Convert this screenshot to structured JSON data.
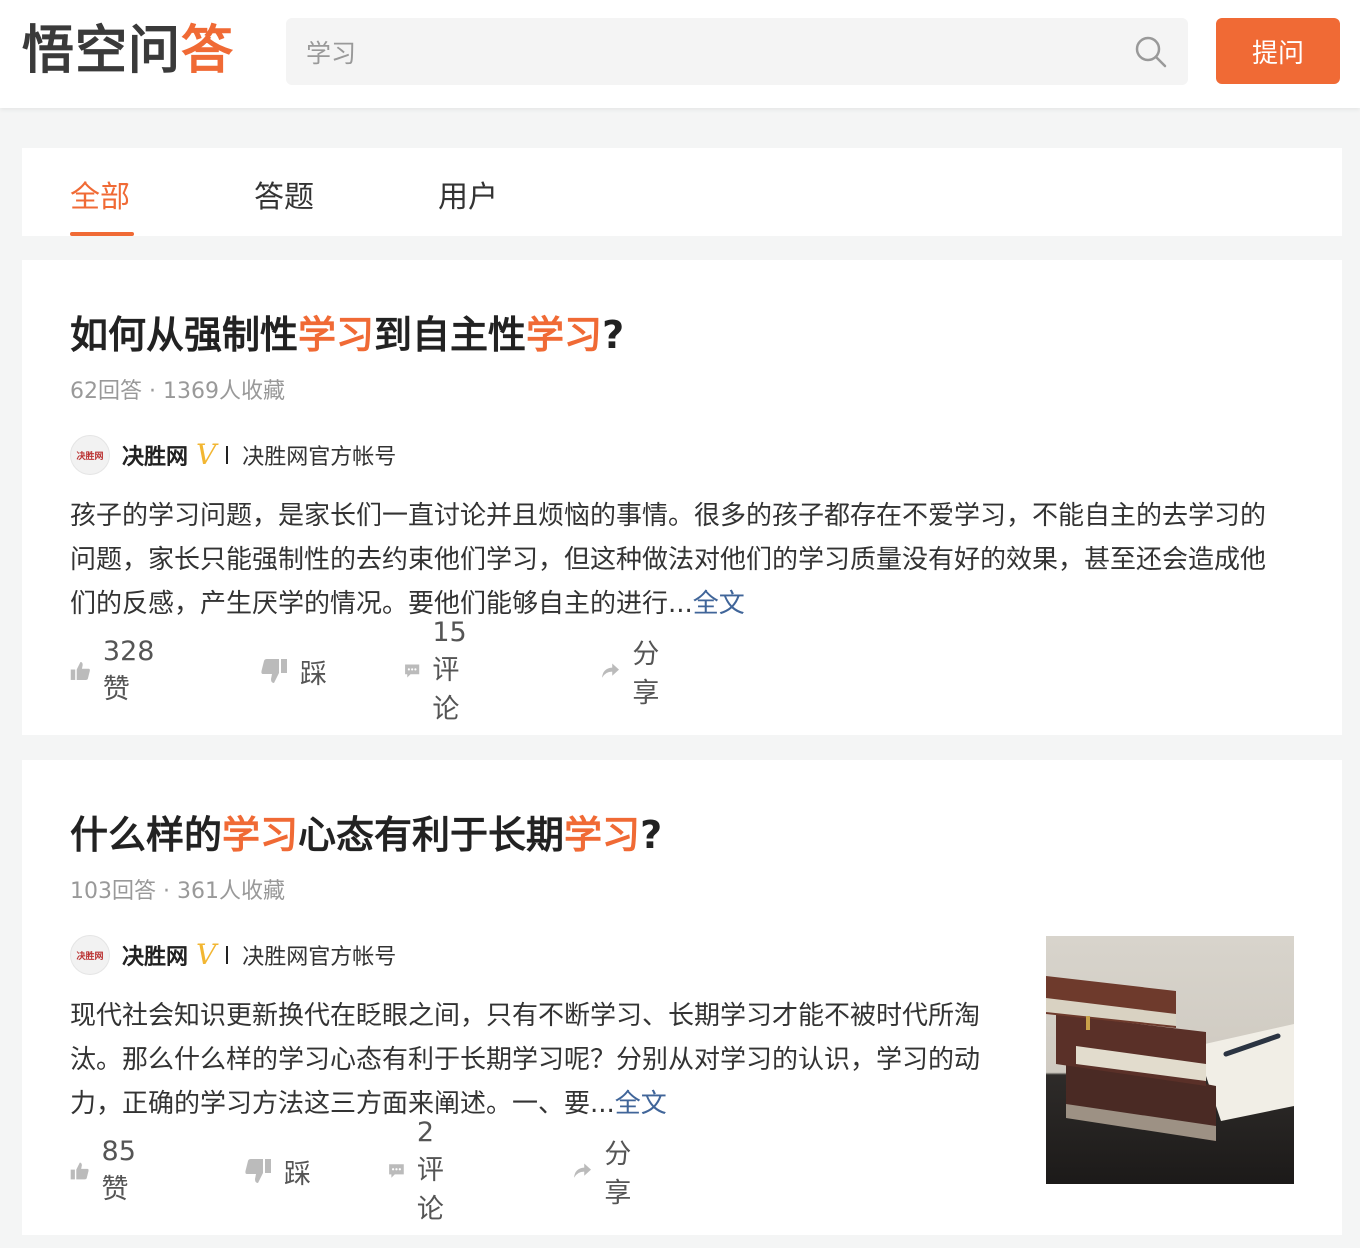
{
  "header": {
    "logo_main": "悟空问",
    "logo_accent": "答",
    "search_value": "学习",
    "ask_label": "提问"
  },
  "tabs": [
    {
      "label": "全部",
      "active": true
    },
    {
      "label": "答题",
      "active": false
    },
    {
      "label": "用户",
      "active": false
    }
  ],
  "questions": [
    {
      "title_parts": [
        "如何从强制性",
        "学习",
        "到自主性",
        "学习",
        "?"
      ],
      "answers_meta": "62回答 · 1369人收藏",
      "author_name": "决胜网",
      "author_desc": "决胜网官方帐号",
      "avatar_text": "决胜网",
      "excerpt": "孩子的学习问题，是家长们一直讨论并且烦恼的事情。很多的孩子都存在不爱学习，不能自主的去学习的问题，家长只能强制性的去约束他们学习，但这种做法对他们的学习质量没有好的效果，甚至还会造成他们的反感，产生厌学的情况。要他们能够自主的进行...",
      "more_label": "全文",
      "likes": "328赞",
      "dislike": "踩",
      "comments": "15评论",
      "share": "分享"
    },
    {
      "title_parts": [
        "什么样的",
        "学习",
        "心态有利于长期",
        "学习",
        "?"
      ],
      "answers_meta": "103回答 · 361人收藏",
      "author_name": "决胜网",
      "author_desc": "决胜网官方帐号",
      "avatar_text": "决胜网",
      "excerpt": "现代社会知识更新换代在眨眼之间，只有不断学习、长期学习才能不被时代所淘汰。那么什么样的学习心态有利于长期学习呢？分别从对学习的认识，学习的动力，正确的学习方法这三方面来阐述。一、要...",
      "more_label": "全文",
      "likes": "85赞",
      "dislike": "踩",
      "comments": "2评论",
      "share": "分享"
    }
  ],
  "colors": {
    "accent": "#f06a35",
    "link": "#406599",
    "verified": "#f2b632"
  },
  "icons": [
    "search-icon",
    "thumbs-up-icon",
    "thumbs-down-icon",
    "comment-icon",
    "share-icon",
    "verified-icon"
  ]
}
